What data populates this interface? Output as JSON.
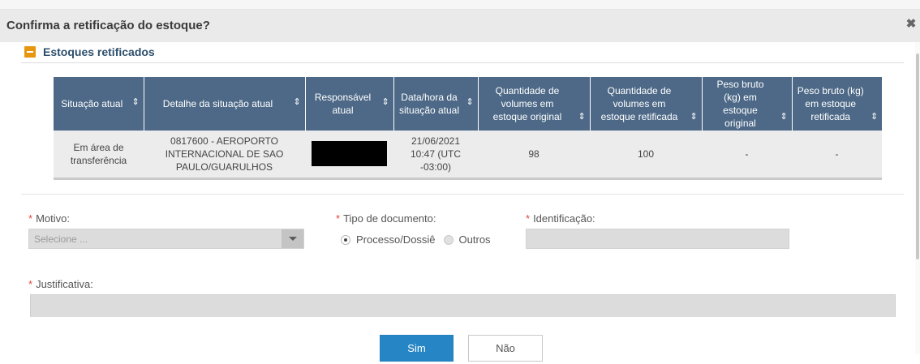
{
  "dialog": {
    "title": "Confirma a retificação do estoque?",
    "close_glyph": "✖"
  },
  "section": {
    "title": "Estoques retificados",
    "toggle_icon": "collapse-minus-icon"
  },
  "table": {
    "columns": [
      "Situação atual",
      "Detalhe da situação atual",
      "Responsável atual",
      "Data/hora da situação atual",
      "Quantidade de volumes em estoque original",
      "Quantidade de volumes em estoque retificada",
      "Peso bruto (kg) em estoque original",
      "Peso bruto (kg) em estoque retificada"
    ],
    "sort_glyph": "⇕",
    "rows": [
      {
        "situacao": "Em área de transferência",
        "detalhe": "0817600 - AEROPORTO INTERNACIONAL DE SAO PAULO/GUARULHOS",
        "responsavel": "",
        "data_hora": "21/06/2021 10:47 (UTC -03:00)",
        "qtd_original": "98",
        "qtd_retificada": "100",
        "peso_original": "-",
        "peso_retificada": "-"
      }
    ]
  },
  "form": {
    "motivo": {
      "label": "Motivo:",
      "placeholder": "Selecione ..."
    },
    "tipo_documento": {
      "label": "Tipo de documento:",
      "options": [
        "Processo/Dossiê",
        "Outros"
      ],
      "selected": "Processo/Dossiê"
    },
    "identificacao": {
      "label": "Identificação:",
      "value": ""
    },
    "justificativa": {
      "label": "Justificativa:",
      "value": ""
    },
    "required_mark": "*"
  },
  "buttons": {
    "confirm": "Sim",
    "cancel": "Não"
  },
  "colors": {
    "accent": "#2686c5",
    "header": "#4d6987",
    "section_title": "#2d4f6c",
    "toggle": "#e8950f",
    "required": "#e2453a"
  }
}
